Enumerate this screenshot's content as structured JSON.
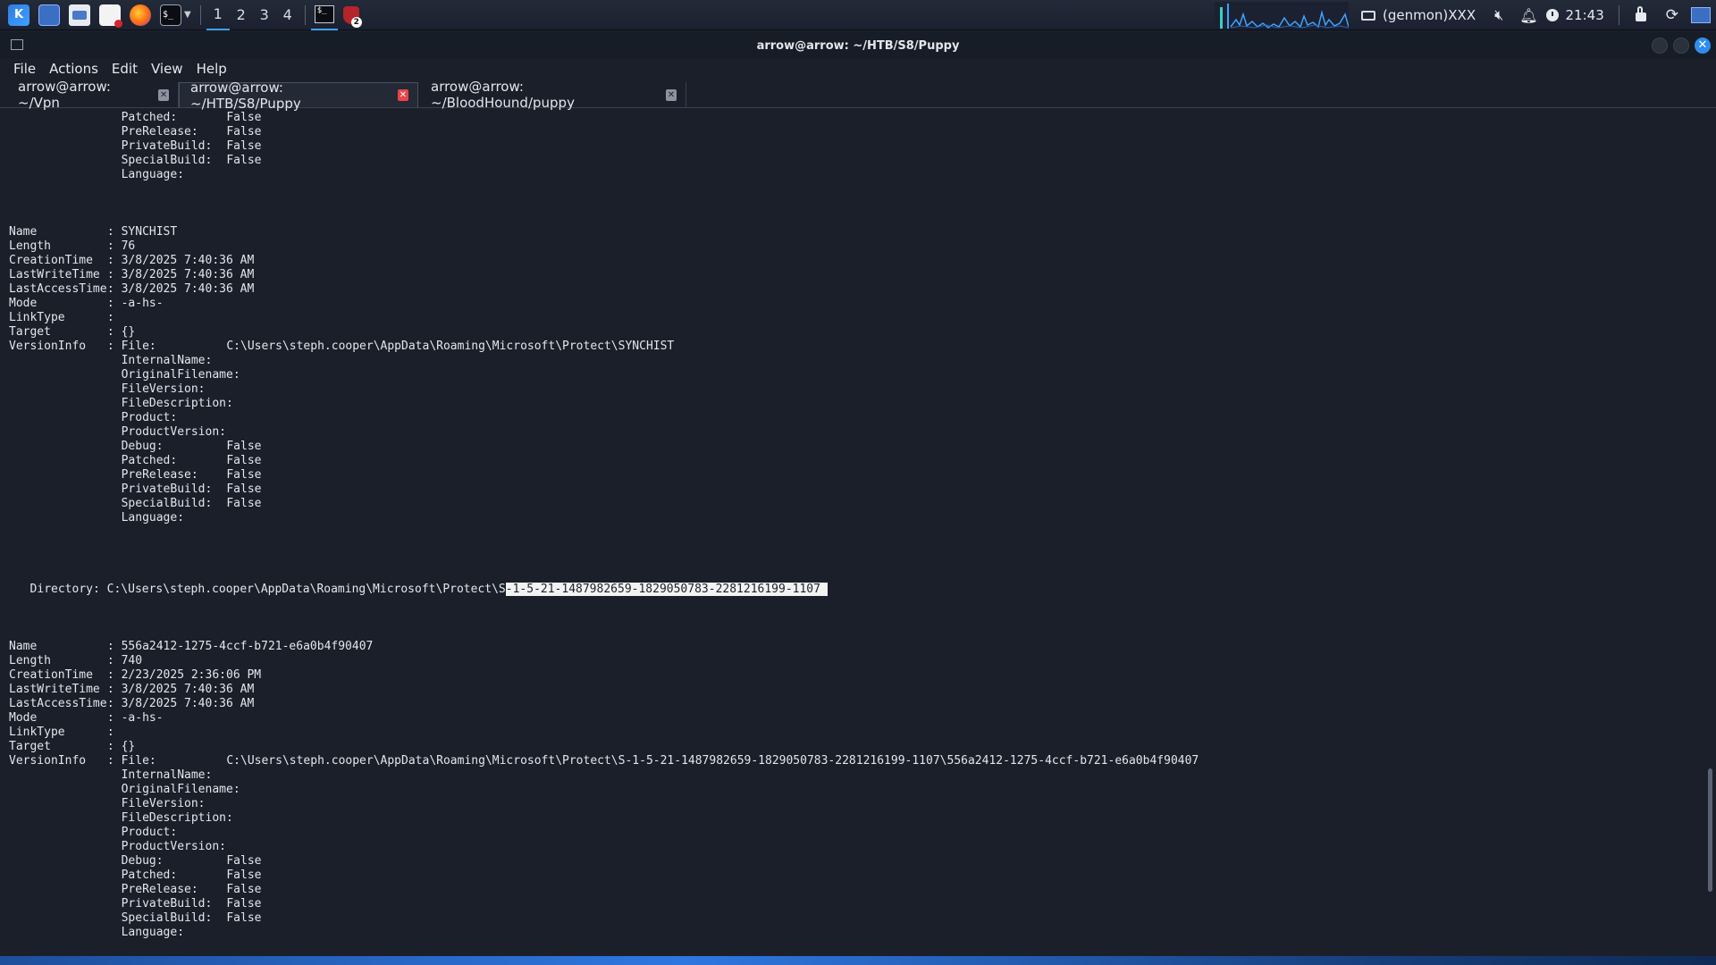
{
  "panel": {
    "workspaces": [
      "1",
      "2",
      "3",
      "4"
    ],
    "active_workspace": "1",
    "terminal_icon_text": "$_",
    "brave_badge": "2",
    "genmon": "(genmon)XXX",
    "clock": "21:43"
  },
  "window": {
    "title": "arrow@arrow: ~/HTB/S8/Puppy",
    "close_glyph": "✕"
  },
  "menu": [
    "File",
    "Actions",
    "Edit",
    "View",
    "Help"
  ],
  "tabs": [
    {
      "label": "arrow@arrow: ~/Vpn",
      "active": false
    },
    {
      "label": "arrow@arrow: ~/HTB/S8/Puppy",
      "active": true
    },
    {
      "label": "arrow@arrow: ~/BloodHound/puppy",
      "active": false
    }
  ],
  "terminal": {
    "block0_tail": [
      {
        "k": "Patched:",
        "v": "False"
      },
      {
        "k": "PreRelease:",
        "v": "False"
      },
      {
        "k": "PrivateBuild:",
        "v": "False"
      },
      {
        "k": "SpecialBuild:",
        "v": "False"
      },
      {
        "k": "Language:",
        "v": ""
      }
    ],
    "file1": {
      "props": [
        {
          "k": "Name",
          "v": "SYNCHIST"
        },
        {
          "k": "Length",
          "v": "76"
        },
        {
          "k": "CreationTime",
          "v": "3/8/2025 7:40:36 AM"
        },
        {
          "k": "LastWriteTime",
          "v": "3/8/2025 7:40:36 AM"
        },
        {
          "k": "LastAccessTime",
          "v": "3/8/2025 7:40:36 AM"
        },
        {
          "k": "Mode",
          "v": "-a-hs-"
        },
        {
          "k": "LinkType",
          "v": ""
        },
        {
          "k": "Target",
          "v": "{}"
        }
      ],
      "versioninfo_label": "VersionInfo",
      "file_label": "File:",
      "file_path": "C:\\Users\\steph.cooper\\AppData\\Roaming\\Microsoft\\Protect\\SYNCHIST",
      "version": [
        {
          "k": "InternalName:",
          "v": ""
        },
        {
          "k": "OriginalFilename:",
          "v": ""
        },
        {
          "k": "FileVersion:",
          "v": ""
        },
        {
          "k": "FileDescription:",
          "v": ""
        },
        {
          "k": "Product:",
          "v": ""
        },
        {
          "k": "ProductVersion:",
          "v": ""
        },
        {
          "k": "Debug:",
          "v": "False"
        },
        {
          "k": "Patched:",
          "v": "False"
        },
        {
          "k": "PreRelease:",
          "v": "False"
        },
        {
          "k": "PrivateBuild:",
          "v": "False"
        },
        {
          "k": "SpecialBuild:",
          "v": "False"
        },
        {
          "k": "Language:",
          "v": ""
        }
      ]
    },
    "directory": {
      "prefix": "Directory: C:\\Users\\steph.cooper\\AppData\\Roaming\\Microsoft\\Protect\\S",
      "highlighted": "-1-5-21-1487982659-1829050783-2281216199-1107 "
    },
    "file2": {
      "props": [
        {
          "k": "Name",
          "v": "556a2412-1275-4ccf-b721-e6a0b4f90407"
        },
        {
          "k": "Length",
          "v": "740"
        },
        {
          "k": "CreationTime",
          "v": "2/23/2025 2:36:06 PM"
        },
        {
          "k": "LastWriteTime",
          "v": "3/8/2025 7:40:36 AM"
        },
        {
          "k": "LastAccessTime",
          "v": "3/8/2025 7:40:36 AM"
        },
        {
          "k": "Mode",
          "v": "-a-hs-"
        },
        {
          "k": "LinkType",
          "v": ""
        },
        {
          "k": "Target",
          "v": "{}"
        }
      ],
      "versioninfo_label": "VersionInfo",
      "file_label": "File:",
      "file_path": "C:\\Users\\steph.cooper\\AppData\\Roaming\\Microsoft\\Protect\\S-1-5-21-1487982659-1829050783-2281216199-1107\\556a2412-1275-4ccf-b721-e6a0b4f90407",
      "version": [
        {
          "k": "InternalName:",
          "v": ""
        },
        {
          "k": "OriginalFilename:",
          "v": ""
        },
        {
          "k": "FileVersion:",
          "v": ""
        },
        {
          "k": "FileDescription:",
          "v": ""
        },
        {
          "k": "Product:",
          "v": ""
        },
        {
          "k": "ProductVersion:",
          "v": ""
        },
        {
          "k": "Debug:",
          "v": "False"
        },
        {
          "k": "Patched:",
          "v": "False"
        },
        {
          "k": "PreRelease:",
          "v": "False"
        },
        {
          "k": "PrivateBuild:",
          "v": "False"
        },
        {
          "k": "SpecialBuild:",
          "v": "False"
        },
        {
          "k": "Language:",
          "v": ""
        }
      ]
    }
  },
  "colors": {
    "accent": "#3ea2ff",
    "terminal_fg": "#e3e6ec",
    "active_tab_close": "#e8454a",
    "selection_bg": "#f2f2f2"
  }
}
